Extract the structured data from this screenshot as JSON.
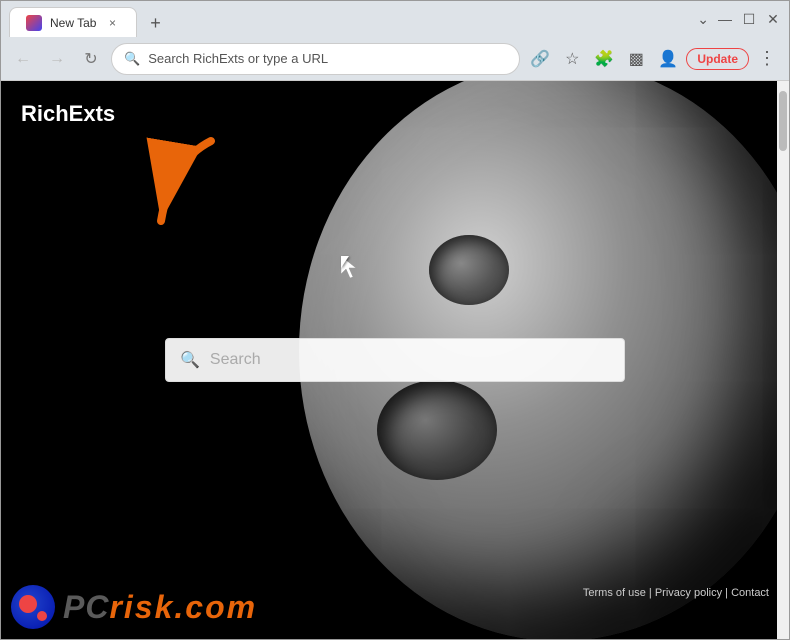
{
  "window": {
    "title": "New Tab",
    "tab_close": "×",
    "new_tab": "+"
  },
  "controls": {
    "minimize": "—",
    "maximize": "☐",
    "close": "✕",
    "chevron_down": "⌄"
  },
  "toolbar": {
    "back_title": "Back",
    "forward_title": "Forward",
    "reload_title": "Reload",
    "address_placeholder": "Search RichExts or type a URL",
    "update_label": "Update",
    "extensions_title": "Extensions",
    "split_screen_title": "Split screen",
    "profile_title": "Profile",
    "menu_title": "More"
  },
  "page": {
    "site_title": "RichExts",
    "search_placeholder": "Search",
    "footer_links": [
      "Terms of use",
      "Privacy policy",
      "Contact"
    ],
    "pcrisk_text": "risk.com"
  }
}
